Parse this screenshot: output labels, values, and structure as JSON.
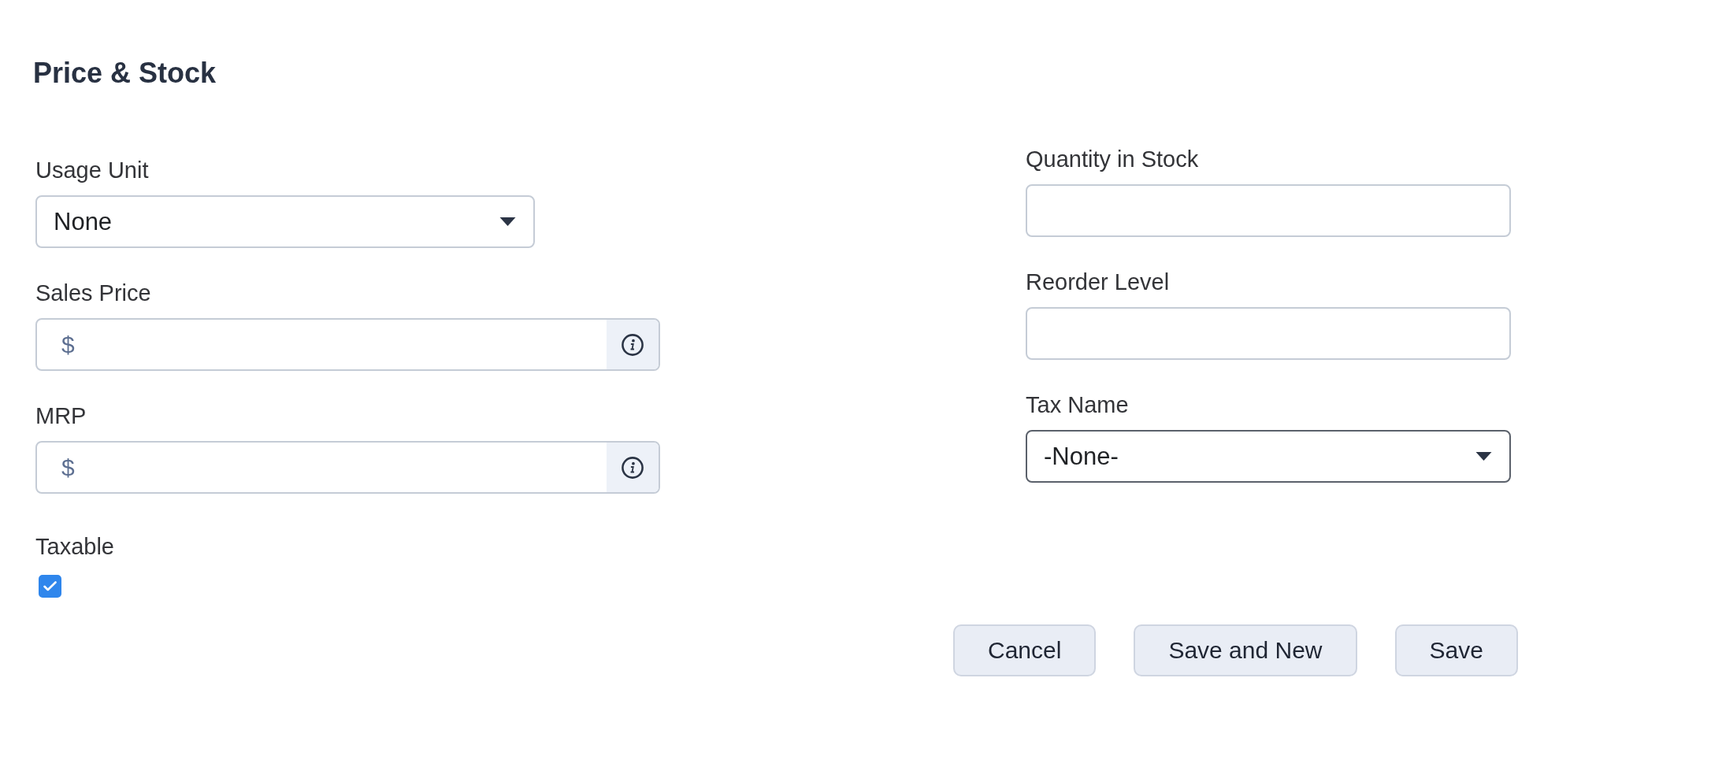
{
  "section": {
    "title": "Price & Stock"
  },
  "left_fields": [
    {
      "kind": "select",
      "label": "Usage Unit",
      "value": "None",
      "focused": false
    },
    {
      "kind": "currency",
      "label": "Sales Price",
      "prefix": "$",
      "focused": false
    },
    {
      "kind": "currency",
      "label": "MRP",
      "prefix": "$",
      "focused": false
    },
    {
      "kind": "checkbox",
      "label": "Taxable",
      "checked": true
    }
  ],
  "right_fields": [
    {
      "kind": "text",
      "label": "Quantity in Stock",
      "focused": false
    },
    {
      "kind": "text",
      "label": "Reorder Level",
      "focused": false
    },
    {
      "kind": "select",
      "label": "Tax Name",
      "value": "-None-",
      "focused": true
    }
  ],
  "buttons": [
    {
      "label": "Cancel"
    },
    {
      "label": "Save and New"
    },
    {
      "label": "Save"
    }
  ]
}
